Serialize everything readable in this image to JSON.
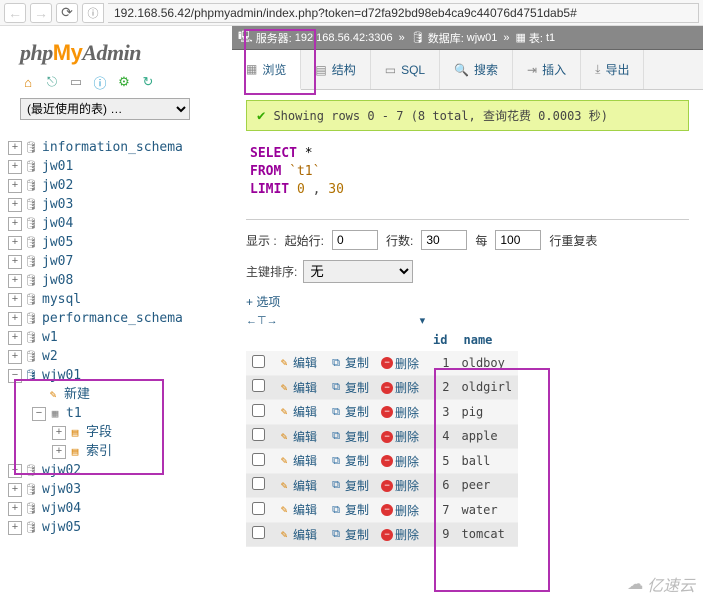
{
  "url": "192.168.56.42/phpmyadmin/index.php?token=d72fa92bd98eb4ca9c44076d4751dab5#",
  "logo": {
    "p1": "php",
    "p2": "My",
    "p3": "Admin"
  },
  "recent_placeholder": "(最近使用的表) …",
  "tree": {
    "dbs": [
      "information_schema",
      "jw01",
      "jw02",
      "jw03",
      "jw04",
      "jw05",
      "jw07",
      "jw08",
      "mysql",
      "performance_schema",
      "w1",
      "w2"
    ],
    "expanded": {
      "name": "wjw01",
      "new_label": "新建",
      "table": "t1",
      "cols_label": "字段",
      "idx_label": "索引"
    },
    "dbs2": [
      "wjw02",
      "wjw03",
      "wjw04",
      "wjw05"
    ]
  },
  "server_bar": {
    "server_label": "服务器:",
    "server": "192.168.56.42:3306",
    "db_label": "数据库:",
    "db": "wjw01",
    "tbl_label": "表:",
    "tbl": "t1"
  },
  "tabs": [
    {
      "icon": "▦",
      "label": "浏览",
      "active": true
    },
    {
      "icon": "▤",
      "label": "结构"
    },
    {
      "icon": "▭",
      "label": "SQL"
    },
    {
      "icon": "🔍",
      "label": "搜索"
    },
    {
      "icon": "⇥",
      "label": "插入"
    },
    {
      "icon": "⤓",
      "label": "导出"
    }
  ],
  "msg": "Showing rows 0 - 7 (8 total, 查询花费 0.0003 秒)",
  "sql": {
    "select": "SELECT",
    "star": "*",
    "from": "FROM",
    "tbl": "`t1`",
    "limit": "LIMIT",
    "n1": "0",
    "n2": "30"
  },
  "display": {
    "label": "显示 :",
    "start_label": "起始行:",
    "start": "0",
    "rows_label": "行数:",
    "rows": "30",
    "each_label": "每",
    "each": "100",
    "repeat_label": "行重复表"
  },
  "pk": {
    "label": "主键排序:",
    "value": "无"
  },
  "options_link": "+ 选项",
  "sort_hdr": "←⊤→",
  "cols": [
    "id",
    "name"
  ],
  "rows": [
    {
      "id": 1,
      "name": "oldboy"
    },
    {
      "id": 2,
      "name": "oldgirl"
    },
    {
      "id": 3,
      "name": "pig"
    },
    {
      "id": 4,
      "name": "apple"
    },
    {
      "id": 5,
      "name": "ball"
    },
    {
      "id": 6,
      "name": "peer"
    },
    {
      "id": 7,
      "name": "water"
    },
    {
      "id": 9,
      "name": "tomcat"
    }
  ],
  "actions": {
    "edit": "编辑",
    "copy": "复制",
    "delete": "删除"
  },
  "watermark": "亿速云"
}
